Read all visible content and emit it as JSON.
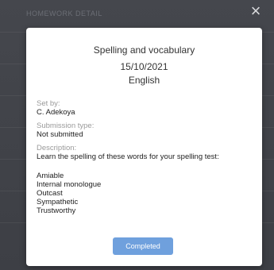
{
  "header": {
    "title": "HOMEWORK DETAIL",
    "close_label": "×"
  },
  "homework": {
    "title": "Spelling and vocabulary",
    "date": "15/10/2021",
    "subject": "English",
    "set_by_label": "Set by:",
    "set_by": "C. Adekoya",
    "submission_type_label": "Submission type:",
    "submission_type": "Not submitted",
    "description_label": "Description:",
    "description": "Learn the spelling of these words for your spelling test:",
    "words": [
      "Amiable",
      "Internal monologue",
      "Outcast",
      "Sympathetic",
      "Trustworthy"
    ]
  },
  "actions": {
    "completed_label": "Completed"
  },
  "colors": {
    "backdrop": "#3f4147",
    "modal_bg": "#ffffff",
    "button_bg": "#6fa0dd"
  }
}
